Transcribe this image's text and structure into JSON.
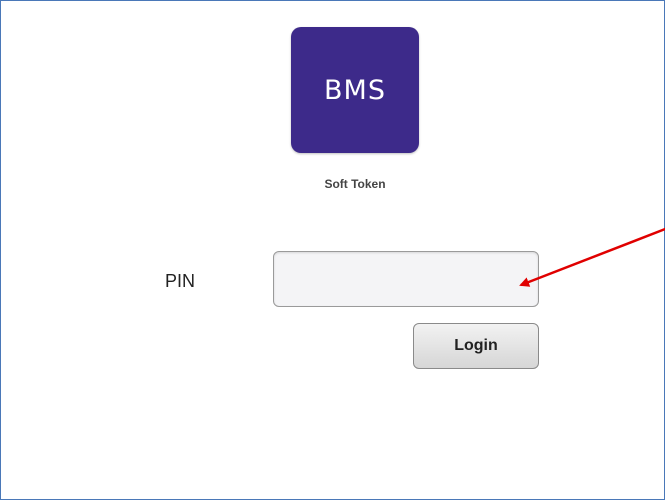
{
  "logo": {
    "text": "BMS",
    "background_color": "#3d2a8a"
  },
  "app": {
    "subtitle": "Soft Token"
  },
  "pin": {
    "label": "PIN",
    "value": "",
    "placeholder": ""
  },
  "login_button": {
    "label": "Login"
  },
  "annotation": {
    "type": "arrow",
    "color": "#e00000",
    "points_to": "pin-input"
  }
}
